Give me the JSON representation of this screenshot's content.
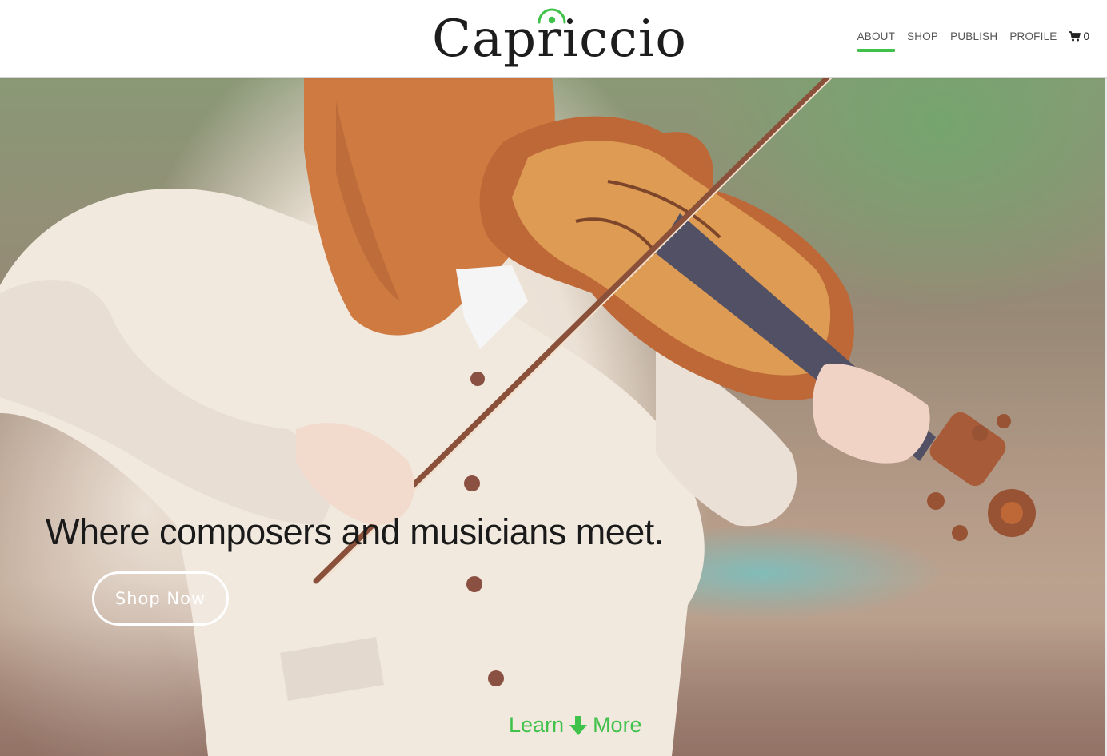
{
  "brand": {
    "name": "Capriccio",
    "accent_color": "#3fc14a"
  },
  "nav": {
    "items": [
      {
        "label": "ABOUT",
        "active": true
      },
      {
        "label": "SHOP",
        "active": false
      },
      {
        "label": "PUBLISH",
        "active": false
      },
      {
        "label": "PROFILE",
        "active": false
      }
    ],
    "cart": {
      "icon": "shopping-cart-icon",
      "count": "0"
    }
  },
  "hero": {
    "heading": "Where composers and musicians meet.",
    "cta_label": "Shop Now",
    "learn_more": {
      "left_text": "Learn",
      "icon": "arrow-down-icon",
      "right_text": "More"
    },
    "image_subject": "violinist"
  }
}
